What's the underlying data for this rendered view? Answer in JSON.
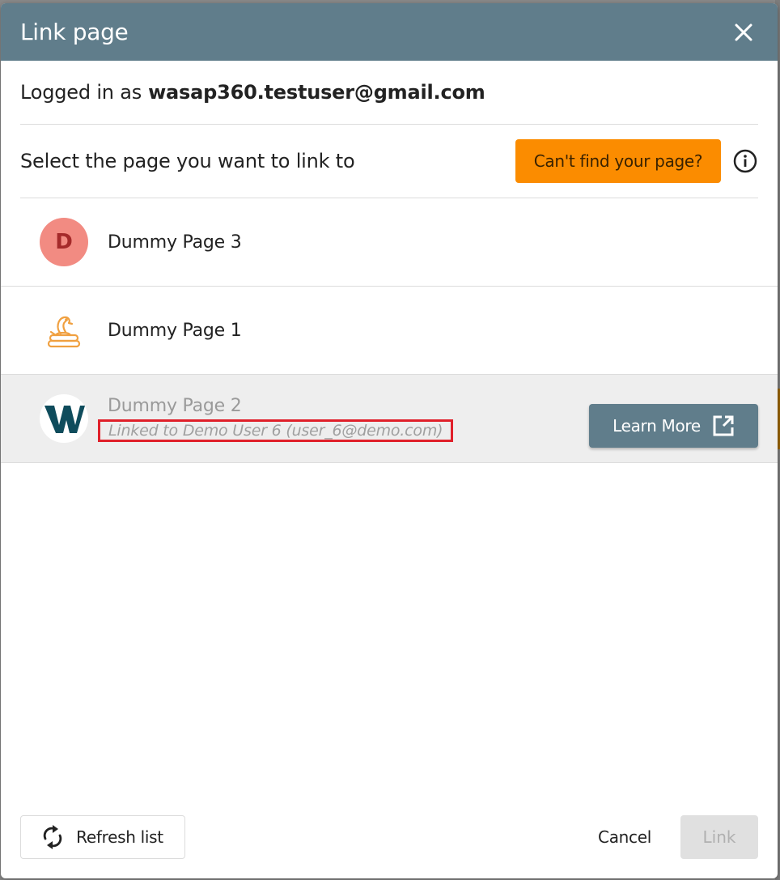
{
  "dialog": {
    "title": "Link page",
    "close_icon": "close-icon"
  },
  "account": {
    "prefix": "Logged in as",
    "email": "wasap360.testuser@gmail.com"
  },
  "selection": {
    "label": "Select the page you want to link to",
    "cant_find_label": "Can't find your page?",
    "info_icon": "info-icon"
  },
  "pages": [
    {
      "name": "Dummy Page 3",
      "avatar": "letter-d",
      "avatar_letter": "D",
      "linked": false
    },
    {
      "name": "Dummy Page 1",
      "avatar": "snake-icon",
      "linked": false
    },
    {
      "name": "Dummy Page 2",
      "avatar": "w-logo",
      "linked": true,
      "linked_note": "Linked to Demo User 6 (user_6@demo.com)",
      "learn_more_label": "Learn More",
      "learn_more_icon": "external-link-icon"
    }
  ],
  "footer": {
    "refresh_label": "Refresh list",
    "refresh_icon": "refresh-icon",
    "cancel_label": "Cancel",
    "link_label": "Link"
  },
  "colors": {
    "header": "#607d8b",
    "accent_orange": "#fb8c00",
    "highlight_red": "#e0202a",
    "avatar_d_bg": "#f28b82",
    "w_logo": "#0f4c5c",
    "snake": "#f0a040"
  }
}
